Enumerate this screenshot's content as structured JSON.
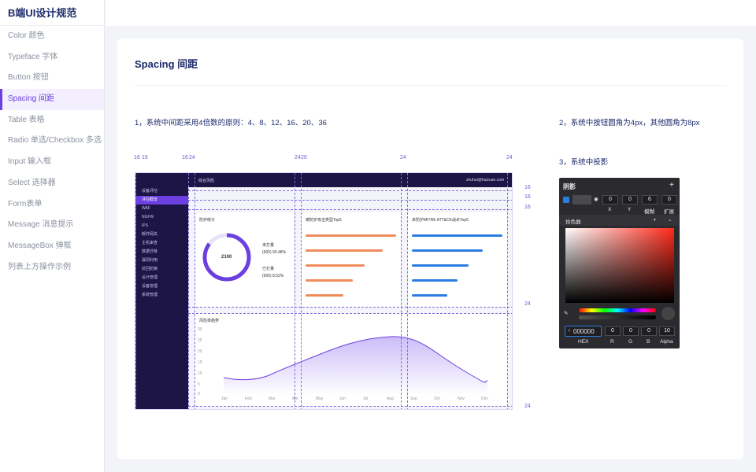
{
  "brand": "B端UI设计规范",
  "nav": [
    {
      "label": "Color 颜色"
    },
    {
      "label": "Typeface 字体"
    },
    {
      "label": "Button 按钮"
    },
    {
      "label": "Spacing 间距",
      "active": true
    },
    {
      "label": "Table 表格"
    },
    {
      "label": "Radio 单选/Checkbox 多选"
    },
    {
      "label": "Input 输入框"
    },
    {
      "label": "Select 选择器"
    },
    {
      "label": "Form表单"
    },
    {
      "label": "Message 消息提示"
    },
    {
      "label": "MessageBox 弹框"
    },
    {
      "label": "列表上方操作示例"
    }
  ],
  "card": {
    "title": "Spacing 间距",
    "rule1": "1，系统中间距采用4倍数的原则：4、8、12、16、20、36",
    "rule2": "2，系统中按钮圆角为4px，其他圆角为8px",
    "rule3": "3，系统中投影"
  },
  "ruler": {
    "top": [
      "16",
      "16",
      "16",
      "24",
      "24",
      "20",
      "24",
      "24"
    ],
    "right": [
      "16",
      "16",
      "16",
      "24",
      "24"
    ]
  },
  "mock": {
    "app_title": "综合风险",
    "user": "zhuhui@huizuan.com",
    "side": [
      "设备评估",
      "评估概览",
      "WAF",
      "NGFW",
      "IPS",
      "邮件网关",
      "主机审查",
      "数据迁移",
      "漏洞利用",
      "抗回防御",
      "设计管理",
      "设备管理",
      "系统管理"
    ],
    "panel1_title": "防护统计",
    "donut_value": "2100",
    "legend1": "未打量",
    "legend1_value": "(900) 90.48%",
    "legend2": "已打量",
    "legend2_value": "(900) 8.52%",
    "panel2_title": "被防护攻击类型Top5",
    "panel3_title": "未防护MITRE ATT&CK战术Top5",
    "panel4_title": "风险率趋势",
    "months": [
      "Jan",
      "Feb",
      "Mar",
      "Apr",
      "May",
      "Jun",
      "Jul",
      "Aug",
      "Sep",
      "Oct",
      "Nov",
      "Dec"
    ],
    "y_ticks": [
      "30",
      "25",
      "20",
      "15",
      "10",
      "5",
      "0"
    ]
  },
  "shadow": {
    "title": "阴影",
    "fields": [
      {
        "label": "X",
        "value": "0"
      },
      {
        "label": "Y",
        "value": "0"
      },
      {
        "label": "模糊",
        "value": "6"
      },
      {
        "label": "扩展",
        "value": "0"
      }
    ],
    "picker_label": "拾色器",
    "hex": "000000",
    "hex_label": "HEX",
    "rgba": [
      {
        "label": "R",
        "value": "0"
      },
      {
        "label": "G",
        "value": "0"
      },
      {
        "label": "B",
        "value": "0"
      },
      {
        "label": "Alpha",
        "value": "10"
      }
    ],
    "colors": {
      "accent": "#6c3fe0",
      "navy": "#1c1545"
    }
  }
}
